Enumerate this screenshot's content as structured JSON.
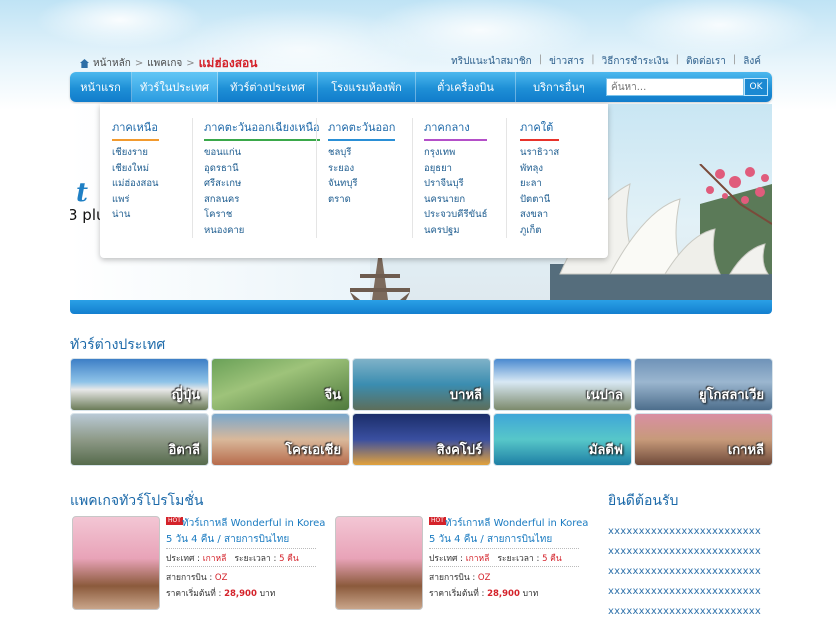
{
  "breadcrumb": {
    "home": "หน้าหลัก",
    "level2": "แพคเกจ",
    "current": "แม่ฮ่องสอน",
    "sep": ">"
  },
  "toplinks": [
    "ทริปแนะนำสมาชิก",
    "ข่าวสาร",
    "วิธีการชำระเงิน",
    "ติดต่อเรา",
    "ลิงค์"
  ],
  "nav": {
    "items": [
      "หน้าแรก",
      "ทัวร์ในประเทศ",
      "ทัวร์ต่างประเทศ",
      "โรงแรมห้องพัก",
      "ตั๋วเครื่องบิน",
      "บริการอื่นๆ"
    ],
    "search_placeholder": "ค้นหา...",
    "search_button": "OK"
  },
  "dropdown": {
    "columns": [
      {
        "head": "ภาคเหนือ",
        "color": "#f29a2e",
        "items": [
          "เชียงราย",
          "เชียงใหม่",
          "แม่ฮ่องสอน",
          "แพร่",
          "น่าน"
        ]
      },
      {
        "head": "ภาคตะวันออกเฉียงเหนือ",
        "color": "#3aa84a",
        "items": [
          "ขอนแก่น",
          "อุดรธานี",
          "ศรีสะเกษ",
          "สกลนคร",
          "โคราช",
          "หนองคาย"
        ]
      },
      {
        "head": "ภาคตะวันออก",
        "color": "#2a8fd6",
        "items": [
          "ชลบุรี",
          "ระยอง",
          "จันทบุรี",
          "ตราด"
        ]
      },
      {
        "head": "ภาคกลาง",
        "color": "#b44fc8",
        "items": [
          "กรุงเทพ",
          "อยุธยา",
          "ปราจีนบุรี",
          "นครนายก",
          "ประจวบคีรีขันธ์",
          "นครปฐม"
        ]
      },
      {
        "head": "ภาคใต้",
        "color": "#e8322a",
        "items": [
          "นราธิวาส",
          "พัทลุง",
          "ยะลา",
          "ปัตตานี",
          "สงขลา",
          "ภูเก็ต"
        ]
      }
    ]
  },
  "banner": {
    "slogan_big": "t",
    "slogan_small": "3 plu"
  },
  "tours_section": {
    "title": "ทัวร์ต่างประเทศ",
    "tiles": [
      "ญี่ปุ่น",
      "จีน",
      "บาหลี",
      "เนปาล",
      "ยูโกสลาเวีย",
      "อิตาลี",
      "โครเอเชีย",
      "สิงคโปร์",
      "มัลดีฟ",
      "เกาหลี"
    ]
  },
  "packages_section": {
    "title": "แพคเกจทัวร์โปรโมชั่น",
    "items": [
      {
        "badge": "HOT",
        "name": "ทัวร์เกาหลี  Wonderful in Korea",
        "sub": "5 วัน 4 คืน / สายการบินไทย",
        "country_label": "ประเทศ :",
        "country": "เกาหลี",
        "duration_label": "ระยะเวลา :",
        "duration": "5 คืน",
        "airline_label": "สายการบิน :",
        "airline": "OZ",
        "price_label": "ราคาเริ่มต้นที่ :",
        "price": "28,900",
        "currency": "บาท"
      },
      {
        "badge": "HOT",
        "name": "ทัวร์เกาหลี  Wonderful in Korea",
        "sub": "5 วัน 4 คืน / สายการบินไทย",
        "country_label": "ประเทศ :",
        "country": "เกาหลี",
        "duration_label": "ระยะเวลา :",
        "duration": "5 คืน",
        "airline_label": "สายการบิน :",
        "airline": "OZ",
        "price_label": "ราคาเริ่มต้นที่ :",
        "price": "28,900",
        "currency": "บาท"
      }
    ]
  },
  "welcome": {
    "title": "ยินดีต้อนรับ",
    "lines": [
      "xxxxxxxxxxxxxxxxxxxxxxxxx",
      "xxxxxxxxxxxxxxxxxxxxxxxxx",
      "xxxxxxxxxxxxxxxxxxxxxxxxx",
      "xxxxxxxxxxxxxxxxxxxxxxxxx",
      "xxxxxxxxxxxxxxxxxxxxxxxxx"
    ]
  }
}
